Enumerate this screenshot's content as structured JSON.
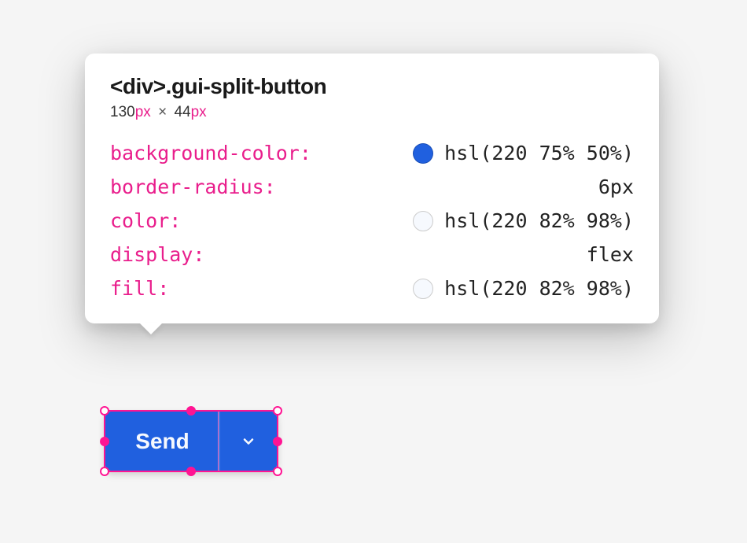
{
  "tooltip": {
    "element_tag": "<div>",
    "element_class": ".gui-split-button",
    "dimensions": {
      "width_num": "130",
      "width_unit": "px",
      "times": "×",
      "height_num": "44",
      "height_unit": "px"
    },
    "properties": [
      {
        "name": "background-color:",
        "value": "hsl(220 75% 50%)",
        "swatch": "blue"
      },
      {
        "name": "border-radius:",
        "value": "6px",
        "swatch": null
      },
      {
        "name": "color:",
        "value": "hsl(220 82% 98%)",
        "swatch": "light"
      },
      {
        "name": "display:",
        "value": "flex",
        "swatch": null
      },
      {
        "name": "fill:",
        "value": "hsl(220 82% 98%)",
        "swatch": "light"
      }
    ]
  },
  "split_button": {
    "primary_label": "Send"
  },
  "colors": {
    "accent_blue": "hsl(220 75% 50%)",
    "text_light": "hsl(220 82% 98%)",
    "selection_pink": "#ff1493",
    "prop_pink": "#e91e8c"
  }
}
